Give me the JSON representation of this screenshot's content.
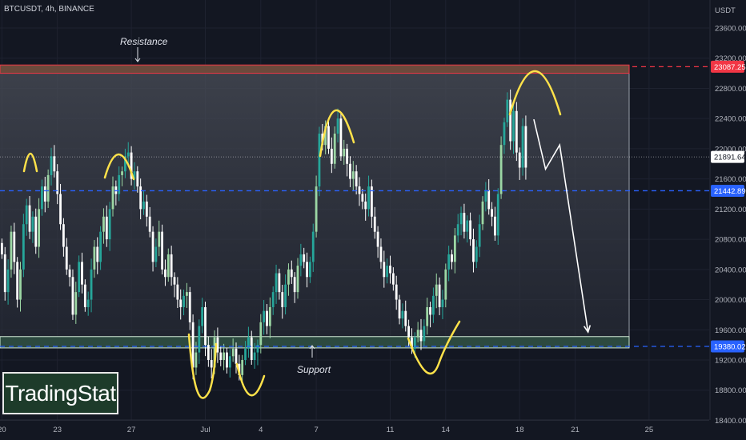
{
  "symbol_label": "BTCUSDT, 4h, BINANCE",
  "logo_text": "TradingStat",
  "colors": {
    "background": "#131722",
    "bull": "#26a69a",
    "bull_light": "#9cd7a4",
    "bear": "#ffffff",
    "resistance": "#f23645",
    "level_blue": "#2962ff",
    "annotation_yellow": "#ffe24a"
  },
  "chart_data": {
    "type": "candlestick",
    "symbol": "BTCUSDT",
    "timeframe": "4h",
    "exchange": "BINANCE",
    "y_axis_label": "USDT",
    "ylim": [
      18200,
      24050
    ],
    "y_ticks": [
      23600,
      23200,
      22800,
      22400,
      22000,
      21600,
      21200,
      20800,
      20400,
      20000,
      19600,
      19200,
      18800,
      18400
    ],
    "x_ticks": [
      {
        "label": "20",
        "bar": 0
      },
      {
        "label": "23",
        "bar": 18
      },
      {
        "label": "27",
        "bar": 42
      },
      {
        "label": "Jul",
        "bar": 66
      },
      {
        "label": "4",
        "bar": 84
      },
      {
        "label": "7",
        "bar": 102
      },
      {
        "label": "11",
        "bar": 126
      },
      {
        "label": "14",
        "bar": 144
      },
      {
        "label": "18",
        "bar": 168
      },
      {
        "label": "21",
        "bar": 186
      },
      {
        "label": "25",
        "bar": 210
      }
    ],
    "price_labels": [
      {
        "value": 23087.25,
        "text": "23087.25",
        "color": "#f23645",
        "style": "dashed"
      },
      {
        "value": 21891.64,
        "text": "21891.64",
        "color": "#ffffff",
        "style": "dotted"
      },
      {
        "value": 21442.89,
        "text": "21442.89",
        "color": "#2962ff",
        "style": "dashed"
      },
      {
        "value": 19380.02,
        "text": "19380.02",
        "color": "#2962ff",
        "style": "dashed"
      }
    ],
    "zones": {
      "resistance": {
        "label": "Resistance",
        "top": 23110,
        "bottom": 23000
      },
      "support": {
        "label": "Support",
        "top": 19510,
        "bottom": 19360
      }
    },
    "candles_close": [
      20600,
      20100,
      20400,
      20900,
      20500,
      20000,
      20400,
      21000,
      21250,
      20900,
      21100,
      20700,
      21200,
      21500,
      21300,
      21650,
      21900,
      21700,
      21400,
      21000,
      20700,
      20400,
      20300,
      19800,
      20100,
      20500,
      20200,
      19900,
      20000,
      20400,
      20700,
      20500,
      20900,
      21100,
      20800,
      21200,
      21500,
      21400,
      21650,
      21700,
      21900,
      21950,
      21600,
      21700,
      21500,
      21200,
      21300,
      21100,
      20900,
      20500,
      20700,
      20900,
      20400,
      20300,
      20600,
      20300,
      20200,
      20000,
      19900,
      20050,
      20100,
      19700,
      19100,
      19300,
      19650,
      19900,
      19400,
      19200,
      19100,
      19500,
      19300,
      19200,
      19300,
      19100,
      19250,
      19350,
      19150,
      19000,
      19200,
      19350,
      19500,
      19200,
      19300,
      19400,
      19700,
      19850,
      19650,
      19900,
      20100,
      20350,
      20100,
      19900,
      20200,
      20400,
      20300,
      20100,
      20450,
      20600,
      20500,
      20300,
      20500,
      20900,
      21500,
      22200,
      22050,
      22300,
      22000,
      21800,
      22200,
      22400,
      21900,
      22000,
      21800,
      21600,
      21700,
      21500,
      21400,
      21300,
      21200,
      21500,
      21100,
      20900,
      20700,
      20500,
      20300,
      20450,
      20350,
      20200,
      20000,
      19750,
      19850,
      19650,
      19500,
      19350,
      19500,
      19600,
      19450,
      19650,
      19900,
      19800,
      20050,
      20200,
      19900,
      20000,
      20400,
      20600,
      20500,
      20850,
      21000,
      21150,
      20900,
      21050,
      20800,
      20500,
      20700,
      21000,
      21300,
      21450,
      21200,
      21100,
      20850,
      21400,
      22050,
      22350,
      22650,
      22100,
      22500,
      21950,
      21750,
      22300,
      21750
    ],
    "projected_path": [
      {
        "bar": 172.6,
        "value": 22390
      },
      {
        "bar": 176.4,
        "value": 21730
      },
      {
        "bar": 181.0,
        "value": 22050
      },
      {
        "bar": 190.2,
        "value": 19570
      }
    ],
    "annotations": {
      "resistance_text": "Resistance",
      "support_text": "Support"
    }
  }
}
